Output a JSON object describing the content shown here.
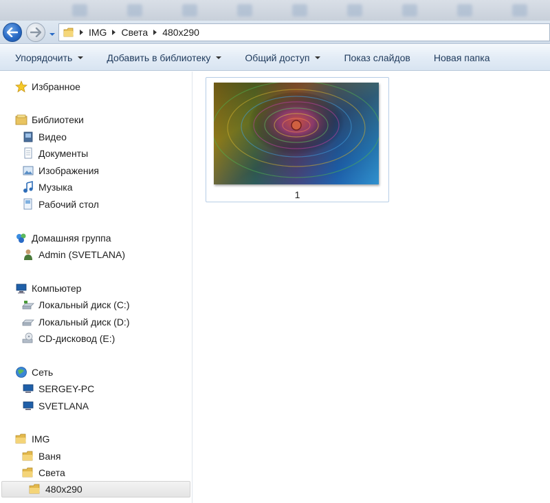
{
  "breadcrumb": [
    "IMG",
    "Света",
    "480x290"
  ],
  "commands": [
    {
      "label": "Упорядочить",
      "dropdown": true
    },
    {
      "label": "Добавить в библиотеку",
      "dropdown": true
    },
    {
      "label": "Общий доступ",
      "dropdown": true
    },
    {
      "label": "Показ слайдов",
      "dropdown": false
    },
    {
      "label": "Новая папка",
      "dropdown": false
    }
  ],
  "sidebar": {
    "favorites": {
      "label": "Избранное",
      "icon": "star-icon"
    },
    "libraries": {
      "label": "Библиотеки",
      "icon": "libraries-icon",
      "items": [
        {
          "label": "Видео",
          "icon": "video-library-icon"
        },
        {
          "label": "Документы",
          "icon": "documents-library-icon"
        },
        {
          "label": "Изображения",
          "icon": "pictures-library-icon"
        },
        {
          "label": "Музыка",
          "icon": "music-library-icon"
        },
        {
          "label": "Рабочий стол",
          "icon": "desktop-icon"
        }
      ]
    },
    "homegroup": {
      "label": "Домашняя группа",
      "icon": "homegroup-icon",
      "items": [
        {
          "label": "Admin (SVETLANA)",
          "icon": "user-icon"
        }
      ]
    },
    "computer": {
      "label": "Компьютер",
      "icon": "computer-icon",
      "items": [
        {
          "label": "Локальный диск (C:)",
          "icon": "system-drive-icon"
        },
        {
          "label": "Локальный диск (D:)",
          "icon": "drive-icon"
        },
        {
          "label": "CD-дисковод (E:)",
          "icon": "cd-drive-icon"
        }
      ]
    },
    "network": {
      "label": "Сеть",
      "icon": "network-icon",
      "items": [
        {
          "label": "SERGEY-PC",
          "icon": "network-computer-icon"
        },
        {
          "label": "SVETLANA",
          "icon": "network-computer-icon"
        }
      ]
    },
    "folders": {
      "label": "IMG",
      "icon": "folder-icon",
      "items": [
        {
          "label": "Ваня",
          "icon": "folder-icon"
        },
        {
          "label": "Света",
          "icon": "folder-icon"
        }
      ],
      "selected": {
        "label": "480x290",
        "icon": "folder-icon"
      }
    }
  },
  "files": [
    {
      "name": "1",
      "type": "image"
    }
  ],
  "colors": {
    "accent": "#2a6bc6",
    "selection_border": "#b6cde6",
    "command_text": "#1e395b"
  }
}
